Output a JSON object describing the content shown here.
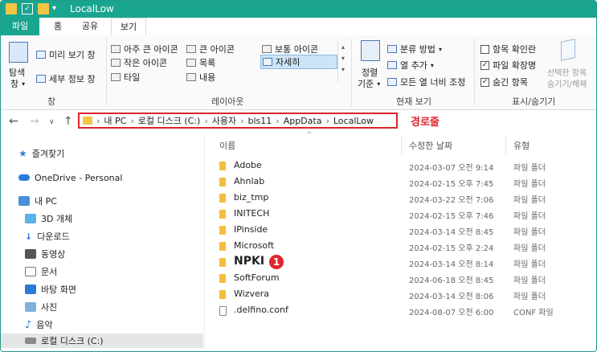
{
  "window": {
    "title": "LocalLow",
    "accent": "#19a58f"
  },
  "ribbon_tabs": [
    "파일",
    "홈",
    "공유",
    "보기"
  ],
  "ribbon": {
    "pane": {
      "nav_pane_label_1": "탐색",
      "nav_pane_label_2": "창",
      "preview": "미리 보기 창",
      "details_pane": "세부 정보 창",
      "group": "창"
    },
    "layout": {
      "extra_large": "아주 큰 아이콘",
      "large": "큰 아이콘",
      "medium": "보통 아이콘",
      "small": "작은 아이콘",
      "list": "목록",
      "details": "자세히",
      "tiles": "타일",
      "content": "내용",
      "group": "레이아웃"
    },
    "current_view": {
      "sort_1": "정렬",
      "sort_2": "기준",
      "group_by": "분류 방법",
      "add_columns": "열 추가",
      "size_all": "모든 열 너비 조정",
      "group": "현재 보기"
    },
    "show_hide": {
      "item_checkboxes": "항목 확인란",
      "extensions": "파일 확장명",
      "hidden_items": "숨긴 항목",
      "hide_selected_1": "선택한 항목",
      "hide_selected_2": "숨기기/해제",
      "group": "표시/숨기기"
    }
  },
  "address": {
    "segments": [
      "내 PC",
      "로컬 디스크 (C:)",
      "사용자",
      "bls11",
      "AppData",
      "LocalLow"
    ],
    "annotation": "경로줄"
  },
  "sidebar": {
    "items": [
      {
        "label": "즐겨찾기"
      },
      {
        "label": "OneDrive - Personal"
      },
      {
        "label": "내 PC"
      },
      {
        "label": "3D 개체"
      },
      {
        "label": "다운로드"
      },
      {
        "label": "동영상"
      },
      {
        "label": "문서"
      },
      {
        "label": "바탕 화면"
      },
      {
        "label": "사진"
      },
      {
        "label": "음악"
      },
      {
        "label": "로컬 디스크 (C:)"
      }
    ]
  },
  "list": {
    "headers": {
      "name": "이름",
      "date": "수정한 날짜",
      "type": "유형"
    },
    "rows": [
      {
        "name": "Adobe",
        "date": "2024-03-07 오전 9:14",
        "type": "파일 폴더"
      },
      {
        "name": "Ahnlab",
        "date": "2024-02-15 오후 7:45",
        "type": "파일 폴더"
      },
      {
        "name": "biz_tmp",
        "date": "2024-03-22 오전 7:06",
        "type": "파일 폴더"
      },
      {
        "name": "INITECH",
        "date": "2024-02-15 오후 7:46",
        "type": "파일 폴더"
      },
      {
        "name": "IPinside",
        "date": "2024-03-14 오전 8:45",
        "type": "파일 폴더"
      },
      {
        "name": "Microsoft",
        "date": "2024-02-15 오후 2:24",
        "type": "파일 폴더"
      },
      {
        "name": "NPKI",
        "date": "2024-03-14 오전 8:14",
        "type": "파일 폴더"
      },
      {
        "name": "SoftForum",
        "date": "2024-06-18 오전 8:45",
        "type": "파일 폴더"
      },
      {
        "name": "Wizvera",
        "date": "2024-03-14 오전 8:06",
        "type": "파일 폴더"
      },
      {
        "name": ".delfino.conf",
        "date": "2024-08-07 오전 6:00",
        "type": "CONF 파일"
      }
    ],
    "npki_badge": "1"
  }
}
